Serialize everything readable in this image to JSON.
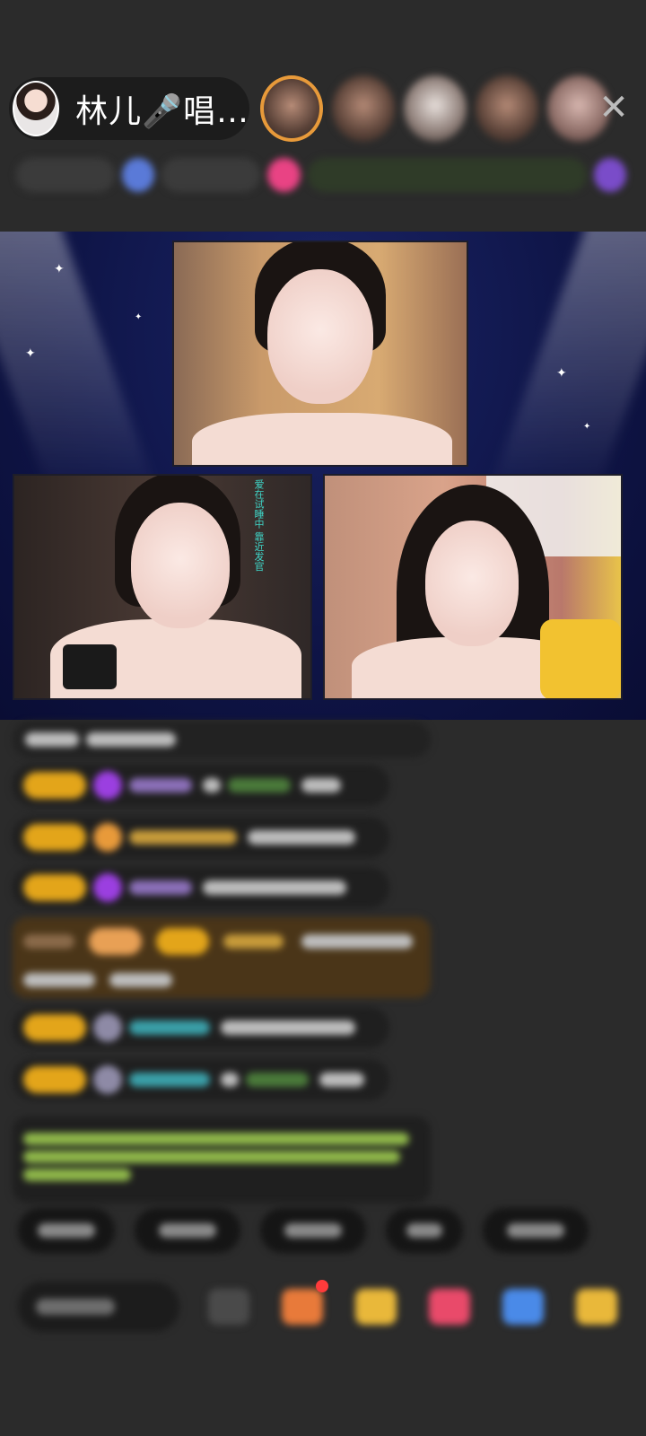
{
  "host": {
    "name": "林儿🎤唱…",
    "avatar_icon": "host-avatar-icon"
  },
  "viewers": [
    {
      "icon": "viewer-avatar-icon",
      "ring": true
    },
    {
      "icon": "viewer-avatar-icon",
      "ring": false
    },
    {
      "icon": "viewer-avatar-icon",
      "ring": false
    },
    {
      "icon": "viewer-avatar-icon",
      "ring": false
    },
    {
      "icon": "viewer-avatar-icon",
      "ring": false
    }
  ],
  "close_icon": "close-icon",
  "colors": {
    "background": "#2b2b2b",
    "stage": "#0f1548",
    "level_badge": "#e3a51a",
    "notice_text": "#8fb84a",
    "accent_pink": "#e94384",
    "vip_bubble": "#4a3518"
  },
  "stage": {
    "feeds": [
      "top-center-feed",
      "bottom-left-feed",
      "bottom-right-feed"
    ],
    "left_feed_caption": "爱在试睡中 靠近发官"
  },
  "icons": {
    "gift": "gift-icon",
    "chat_bubble": "chat-bubble-icon",
    "game": "game-icon",
    "treasure": "treasure-icon"
  }
}
